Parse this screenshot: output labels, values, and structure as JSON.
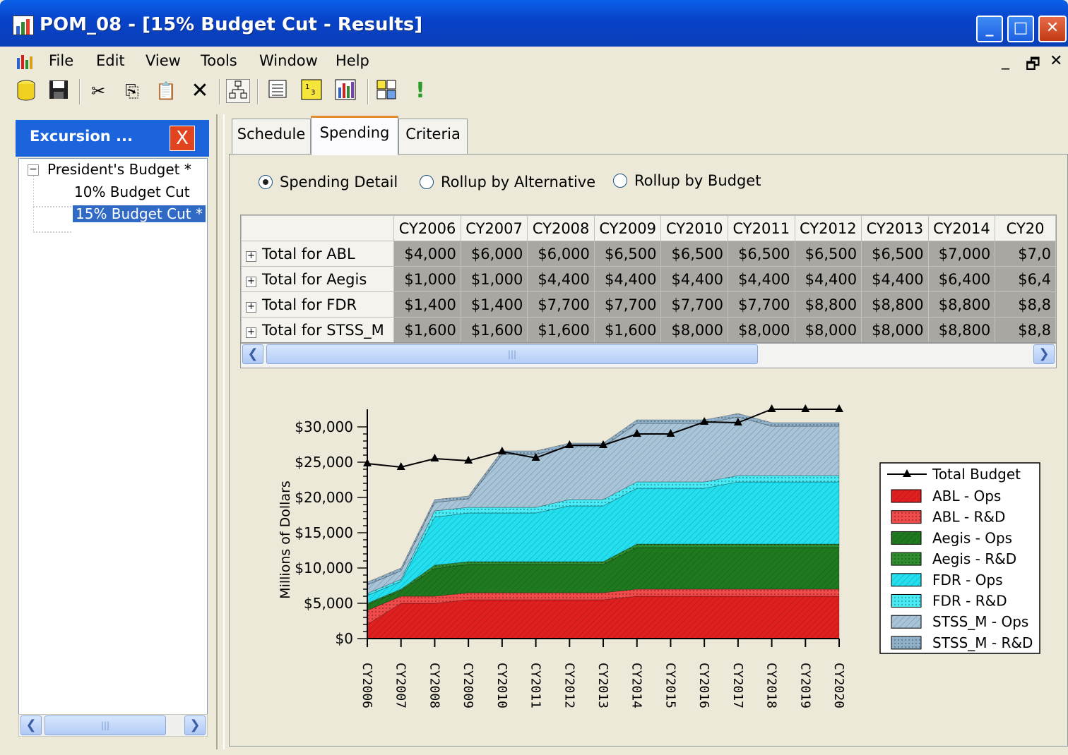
{
  "window": {
    "title": "POM_08 - [15% Budget Cut - Results]"
  },
  "menu": [
    "File",
    "Edit",
    "View",
    "Tools",
    "Window",
    "Help"
  ],
  "toolbar": {
    "icons": [
      "database-icon",
      "save-icon",
      "cut-icon",
      "copy-icon",
      "paste-icon",
      "delete-icon",
      "hierarchy-icon",
      "list-icon",
      "table-icon",
      "chart-icon",
      "layout-icon",
      "run-icon"
    ]
  },
  "left_panel": {
    "title": "Excursion ...",
    "tree": {
      "root": "President's Budget *",
      "children": [
        "10% Budget Cut",
        "15% Budget Cut *"
      ]
    }
  },
  "tabs": [
    "Schedule",
    "Spending",
    "Criteria"
  ],
  "view_options": [
    "Spending Detail",
    "Rollup by Alternative",
    "Rollup by Budget"
  ],
  "grid": {
    "columns": [
      "CY2006",
      "CY2007",
      "CY2008",
      "CY2009",
      "CY2010",
      "CY2011",
      "CY2012",
      "CY2013",
      "CY2014",
      "CY20"
    ],
    "rows": [
      {
        "label": "Total for ABL",
        "values": [
          "$4,000",
          "$6,000",
          "$6,000",
          "$6,500",
          "$6,500",
          "$6,500",
          "$6,500",
          "$6,500",
          "$7,000",
          "$7,0"
        ]
      },
      {
        "label": "Total for Aegis",
        "values": [
          "$1,000",
          "$1,000",
          "$4,400",
          "$4,400",
          "$4,400",
          "$4,400",
          "$4,400",
          "$4,400",
          "$6,400",
          "$6,4"
        ]
      },
      {
        "label": "Total for FDR",
        "values": [
          "$1,400",
          "$1,400",
          "$7,700",
          "$7,700",
          "$7,700",
          "$7,700",
          "$8,800",
          "$8,800",
          "$8,800",
          "$8,8"
        ]
      },
      {
        "label": "Total for STSS_M",
        "values": [
          "$1,600",
          "$1,600",
          "$1,600",
          "$1,600",
          "$8,000",
          "$8,000",
          "$8,000",
          "$8,000",
          "$8,800",
          "$8,8"
        ]
      }
    ]
  },
  "chart_data": {
    "type": "area",
    "ylabel": "Millions of Dollars",
    "ylim": [
      0,
      30000
    ],
    "yticks": [
      "$0",
      "$5,000",
      "$10,000",
      "$15,000",
      "$20,000",
      "$25,000",
      "$30,000"
    ],
    "categories": [
      "CY2006",
      "CY2007",
      "CY2008",
      "CY2009",
      "CY2010",
      "CY2011",
      "CY2012",
      "CY2013",
      "CY2014",
      "CY2015",
      "CY2016",
      "CY2017",
      "CY2018",
      "CY2019",
      "CY2020"
    ],
    "series": [
      {
        "name": "ABL - Ops",
        "color": "#e02020",
        "values": [
          2000,
          5000,
          5000,
          5500,
          5500,
          5500,
          5500,
          5500,
          6000,
          6000,
          6000,
          6000,
          6000,
          6000,
          6000
        ]
      },
      {
        "name": "ABL - R&D",
        "color": "#f04a4a",
        "values": [
          2000,
          1000,
          1000,
          1000,
          1000,
          1000,
          1000,
          1000,
          1000,
          1000,
          1000,
          1000,
          1000,
          1000,
          1000
        ]
      },
      {
        "name": "Aegis - Ops",
        "color": "#1f7a1f",
        "values": [
          800,
          800,
          3900,
          4000,
          4000,
          4000,
          4000,
          4000,
          5900,
          5900,
          5900,
          5900,
          5900,
          5900,
          5900
        ]
      },
      {
        "name": "Aegis - R&D",
        "color": "#2e8b2e",
        "values": [
          200,
          200,
          500,
          400,
          400,
          400,
          400,
          400,
          500,
          500,
          500,
          500,
          500,
          500,
          500
        ]
      },
      {
        "name": "FDR - Ops",
        "color": "#22e0f0",
        "values": [
          1100,
          1100,
          6800,
          6900,
          6900,
          6900,
          7900,
          7900,
          7900,
          7900,
          7900,
          8800,
          8800,
          8800,
          8800
        ]
      },
      {
        "name": "FDR - R&D",
        "color": "#48eaf5",
        "values": [
          300,
          300,
          900,
          800,
          800,
          800,
          900,
          900,
          900,
          900,
          900,
          900,
          900,
          900,
          900
        ]
      },
      {
        "name": "STSS_M - Ops",
        "color": "#a8c4d8",
        "values": [
          1200,
          1200,
          1200,
          1200,
          7500,
          7500,
          7500,
          7500,
          8300,
          8300,
          8300,
          8300,
          7000,
          7000,
          7000
        ]
      },
      {
        "name": "STSS_M - R&D",
        "color": "#8fb0c8",
        "values": [
          400,
          400,
          400,
          400,
          500,
          500,
          500,
          500,
          500,
          500,
          500,
          500,
          500,
          500,
          500
        ]
      }
    ],
    "line": {
      "name": "Total Budget",
      "color": "#000000",
      "values": [
        24800,
        24300,
        25500,
        25200,
        26500,
        25600,
        27400,
        27400,
        29000,
        29000,
        30700,
        30600,
        32500,
        32500,
        32500
      ]
    }
  }
}
